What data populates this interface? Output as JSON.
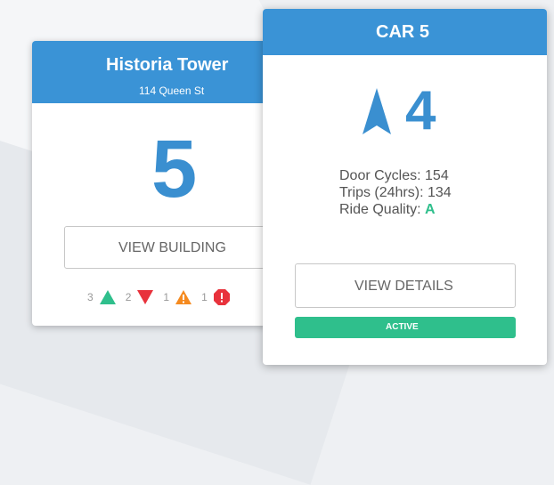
{
  "building": {
    "name": "Historia Tower",
    "address": "114 Queen St",
    "count": "5",
    "view_button": "VIEW BUILDING",
    "alerts": [
      {
        "count": "3",
        "icon": "triangle-up-icon",
        "color": "#2fbf8c"
      },
      {
        "count": "2",
        "icon": "triangle-down-icon",
        "color": "#e8323c"
      },
      {
        "count": "1",
        "icon": "warning-icon",
        "color": "#f58a1f"
      },
      {
        "count": "1",
        "icon": "error-octagon-icon",
        "color": "#e8323c"
      }
    ]
  },
  "car": {
    "title": "CAR 5",
    "direction_icon": "arrow-up-icon",
    "floor": "4",
    "stats": {
      "door_cycles_label": "Door Cycles: 154",
      "trips_label": "Trips (24hrs): 134",
      "ride_quality_label": "Ride Quality: ",
      "ride_quality_value": "A"
    },
    "view_button": "VIEW DETAILS",
    "status": "ACTIVE"
  },
  "colors": {
    "header_blue": "#3a93d6",
    "accent_green": "#2fbf8c",
    "alert_red": "#e8323c",
    "warning_orange": "#f58a1f"
  }
}
